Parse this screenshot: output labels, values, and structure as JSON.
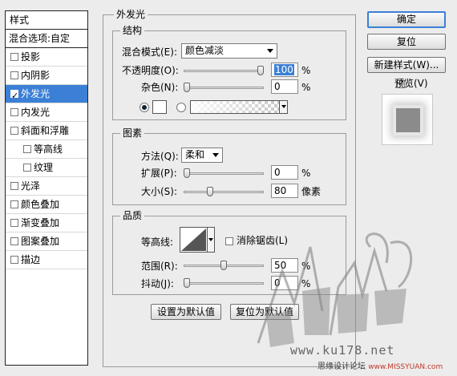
{
  "styles_panel": {
    "header": "样式",
    "blend_options": "混合选项:自定",
    "items": [
      {
        "label": "投影",
        "checked": false,
        "indent": false,
        "selected": false
      },
      {
        "label": "内阴影",
        "checked": false,
        "indent": false,
        "selected": false
      },
      {
        "label": "外发光",
        "checked": true,
        "indent": false,
        "selected": true
      },
      {
        "label": "内发光",
        "checked": false,
        "indent": false,
        "selected": false
      },
      {
        "label": "斜面和浮雕",
        "checked": false,
        "indent": false,
        "selected": false
      },
      {
        "label": "等高线",
        "checked": false,
        "indent": true,
        "selected": false
      },
      {
        "label": "纹理",
        "checked": false,
        "indent": true,
        "selected": false
      },
      {
        "label": "光泽",
        "checked": false,
        "indent": false,
        "selected": false
      },
      {
        "label": "颜色叠加",
        "checked": false,
        "indent": false,
        "selected": false
      },
      {
        "label": "渐变叠加",
        "checked": false,
        "indent": false,
        "selected": false
      },
      {
        "label": "图案叠加",
        "checked": false,
        "indent": false,
        "selected": false
      },
      {
        "label": "描边",
        "checked": false,
        "indent": false,
        "selected": false
      }
    ]
  },
  "outer_glow": {
    "title": "外发光",
    "structure": {
      "title": "结构",
      "blend_mode_label": "混合模式(E):",
      "blend_mode_value": "颜色减淡",
      "opacity_label": "不透明度(O):",
      "opacity_value": "100",
      "opacity_level": 1.0,
      "noise_label": "杂色(N):",
      "noise_value": "0",
      "noise_level": 0.0,
      "unit_percent": "%",
      "color_mode": "solid",
      "swatch_color": "#ffffff"
    },
    "elements": {
      "title": "图素",
      "technique_label": "方法(Q):",
      "technique_value": "柔和",
      "spread_label": "扩展(P):",
      "spread_value": "0",
      "spread_level": 0.0,
      "size_label": "大小(S):",
      "size_value": "80",
      "size_level": 0.32,
      "unit_percent": "%",
      "unit_pixels": "像素"
    },
    "quality": {
      "title": "品质",
      "contour_label": "等高线:",
      "antialias_label": "消除锯齿(L)",
      "antialias_checked": false,
      "range_label": "范围(R):",
      "range_value": "50",
      "range_level": 0.5,
      "jitter_label": "抖动(J):",
      "jitter_value": "0",
      "jitter_level": 0.0,
      "unit_percent": "%"
    },
    "make_default": "设置为默认值",
    "reset_default": "复位为默认值"
  },
  "side_buttons": {
    "ok": "确定",
    "reset": "复位",
    "new_style": "新建样式(W)...",
    "preview_label": "预览(V)",
    "preview_checked": true
  },
  "watermark": {
    "url": "www.ku178.net",
    "forum": "思缘设计论坛",
    "site": "www.MISSYUAN.com"
  },
  "colors": {
    "selection": "#3b80d6",
    "dialog_bg": "#ececec",
    "preview_swatch": "#8b8b8b"
  }
}
